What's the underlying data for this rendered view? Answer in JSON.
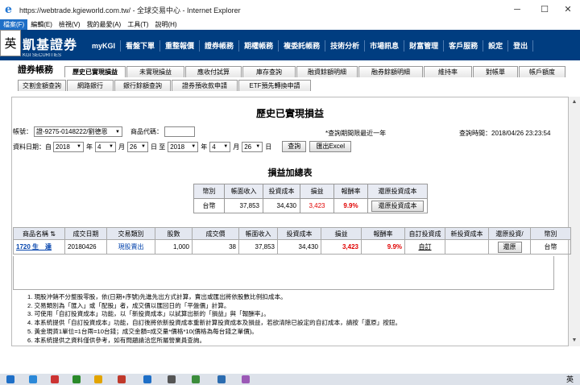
{
  "browser": {
    "url": "https://webtrade.kgieworld.com.tw/",
    "title_suffix": " - 全球交易中心 - Internet Explorer",
    "menu": [
      "檔案(F)",
      "編輯(E)",
      "檢視(V)",
      "我的最愛(A)",
      "工具(T)",
      "說明(H)"
    ],
    "ime": "英"
  },
  "brand": {
    "name": "凱基證券",
    "sub": "KGI SECURITIES"
  },
  "topnav": [
    "myKGI",
    "看盤下單",
    "重整報價",
    "證券帳務",
    "期權帳務",
    "複委託帳務",
    "技術分析",
    "市場訊息",
    "財富管理",
    "客戶服務",
    "設定",
    "登出"
  ],
  "page_header": "證券帳務",
  "tabs_row1": [
    "歷史已實現損益",
    "未實現損益",
    "應收付試算",
    "庫存查詢",
    "融資餘額明細",
    "融券餘額明細",
    "維持率",
    "對帳單",
    "帳戶額度"
  ],
  "tabs_row2": [
    "交割金額查詢",
    "網路銀行",
    "銀行餘額查詢",
    "證券預收款申請",
    "ETF預先轉換申請"
  ],
  "main": {
    "title": "歷史已實現損益",
    "account_label": "帳號：",
    "account_value": "證-9275-0148222/劉德恩",
    "code_label": "商品代碼：",
    "code_value": "",
    "note": "*查詢期間限最近一年",
    "query_time_label": "查詢時間：",
    "query_time": "2018/04/26 23:23:54",
    "date_label": "資料日期：自",
    "from_year": "2018",
    "from_month": "4",
    "from_day": "26",
    "to_label": "日 至",
    "to_year": "2018",
    "to_month": "4",
    "to_day": "26",
    "year_u": "年",
    "month_u": "月",
    "day_u": "日",
    "query_btn": "查詢",
    "excel_btn": "匯出Excel"
  },
  "summary": {
    "title": "損益加總表",
    "headers": [
      "幣別",
      "帳面收入",
      "投資成本",
      "損益",
      "報酬率",
      "還原投資成本"
    ],
    "row": {
      "currency": "台幣",
      "income": "37,853",
      "cost": "34,430",
      "pnl": "3,423",
      "rate": "9.9%",
      "btn": "還原投資成本"
    }
  },
  "detail": {
    "headers": [
      "商品名稱",
      "成交日期",
      "交易類別",
      "股數",
      "成交價",
      "帳面收入",
      "投資成本",
      "損益",
      "報酬率",
      "自訂投資成",
      "新投資成本",
      "還原投資/",
      "幣別"
    ],
    "rows": [
      {
        "name": "1720 生　達",
        "date": "20180426",
        "type": "現股賣出",
        "shares": "1,000",
        "price": "38",
        "income": "37,853",
        "cost": "34,430",
        "pnl": "3,423",
        "rate": "9.9%",
        "custom": "自訂",
        "newcost": "",
        "restore": "還原",
        "currency": "台幣"
      }
    ]
  },
  "notes": [
    "1.  現股沖銷不分整股零股，依(日期+序號)先進先出方式計算，賣出或匯出將依股數比例扣成本。",
    "2.  交易類別為「匯入」或「配股」者，成交價以匯回日的「平盤價」計算。",
    "3.  可使用「自訂投資成本」功能，以「新投資成本」以試算出新的「損益」與「報酬率」。",
    "4.  本系統提供「自訂投資成本」功能，自訂後將依新投資成本重新計算投資成本及損益，若欲清除已設定的自訂成本，請按「還原」按鈕。",
    "5.  黃金現貨1單位=1台兩=10台錢；成交金額=成交量*價格*10(價格為每台錢之單價)。",
    "6.  本系統提供之資料僅供參考，如有問題請洽您所屬營業員查詢。"
  ],
  "taskbar": {
    "ime": "英"
  }
}
